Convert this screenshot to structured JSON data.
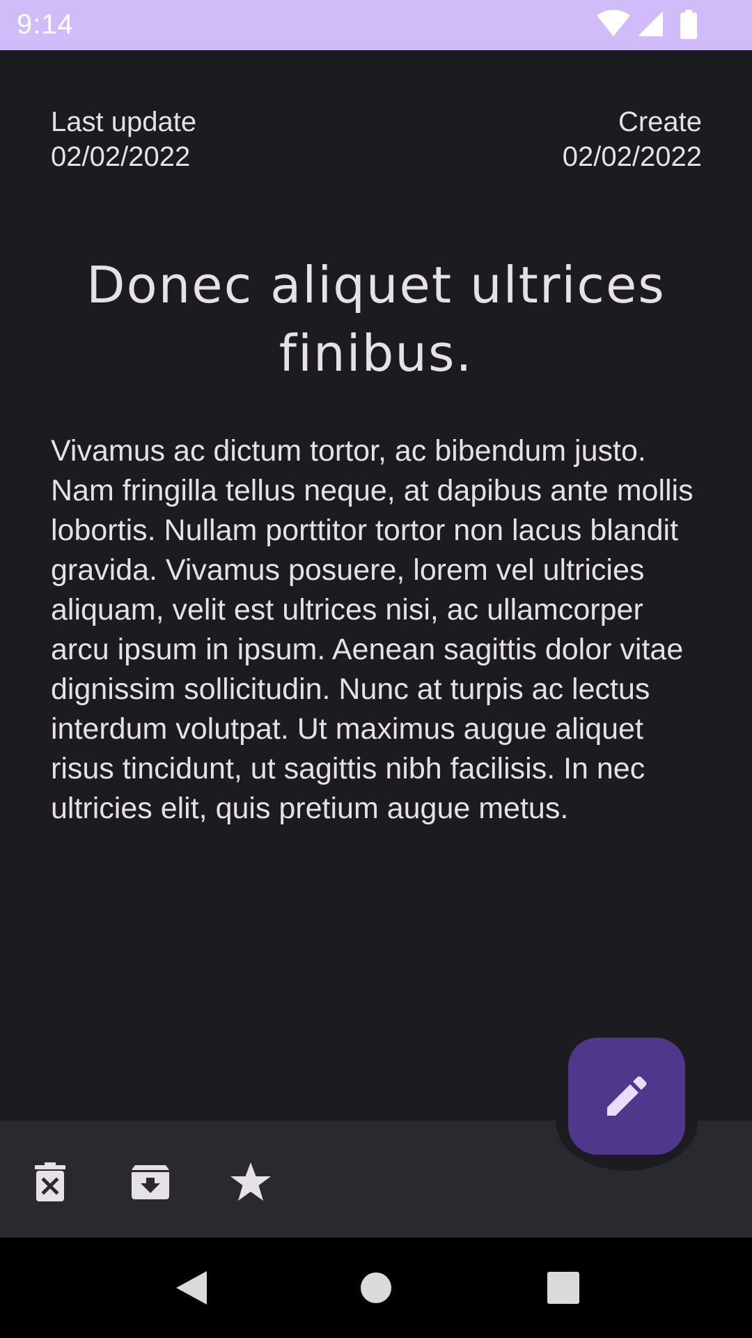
{
  "status_bar": {
    "time": "9:14",
    "icons": [
      "wifi-icon",
      "cellular-signal-icon",
      "battery-icon"
    ]
  },
  "note": {
    "last_update_label": "Last update",
    "last_update_date": "02/02/2022",
    "create_label": "Create",
    "create_date": "02/02/2022",
    "title": "Donec aliquet ultrices finibus.",
    "body": "Vivamus ac dictum tortor, ac bibendum justo. Nam fringilla tellus neque, at dapibus ante mollis lobortis. Nullam porttitor tortor non lacus blandit gravida. Vivamus posuere, lorem vel ultricies aliquam, velit est ultrices nisi, ac ullamcorper arcu ipsum in ipsum. Aenean sagittis dolor vitae dignissim sollicitudin. Nunc at turpis ac lectus interdum volutpat. Ut maximus augue aliquet risus tincidunt, ut sagittis nibh facilisis. In nec ultricies elit, quis pretium augue metus."
  },
  "bottom_bar": {
    "actions": [
      "delete-icon",
      "archive-icon",
      "star-icon"
    ],
    "fab_icon": "edit-icon"
  },
  "nav_bar": {
    "buttons": [
      "back-icon",
      "home-icon",
      "recents-icon"
    ]
  },
  "colors": {
    "background": "#1c1b20",
    "status_bar": "#cfbcf9",
    "bottom_bar": "#2b2930",
    "fab": "#4f378b",
    "fab_icon": "#e9ddff",
    "text": "#e6e1e6"
  }
}
